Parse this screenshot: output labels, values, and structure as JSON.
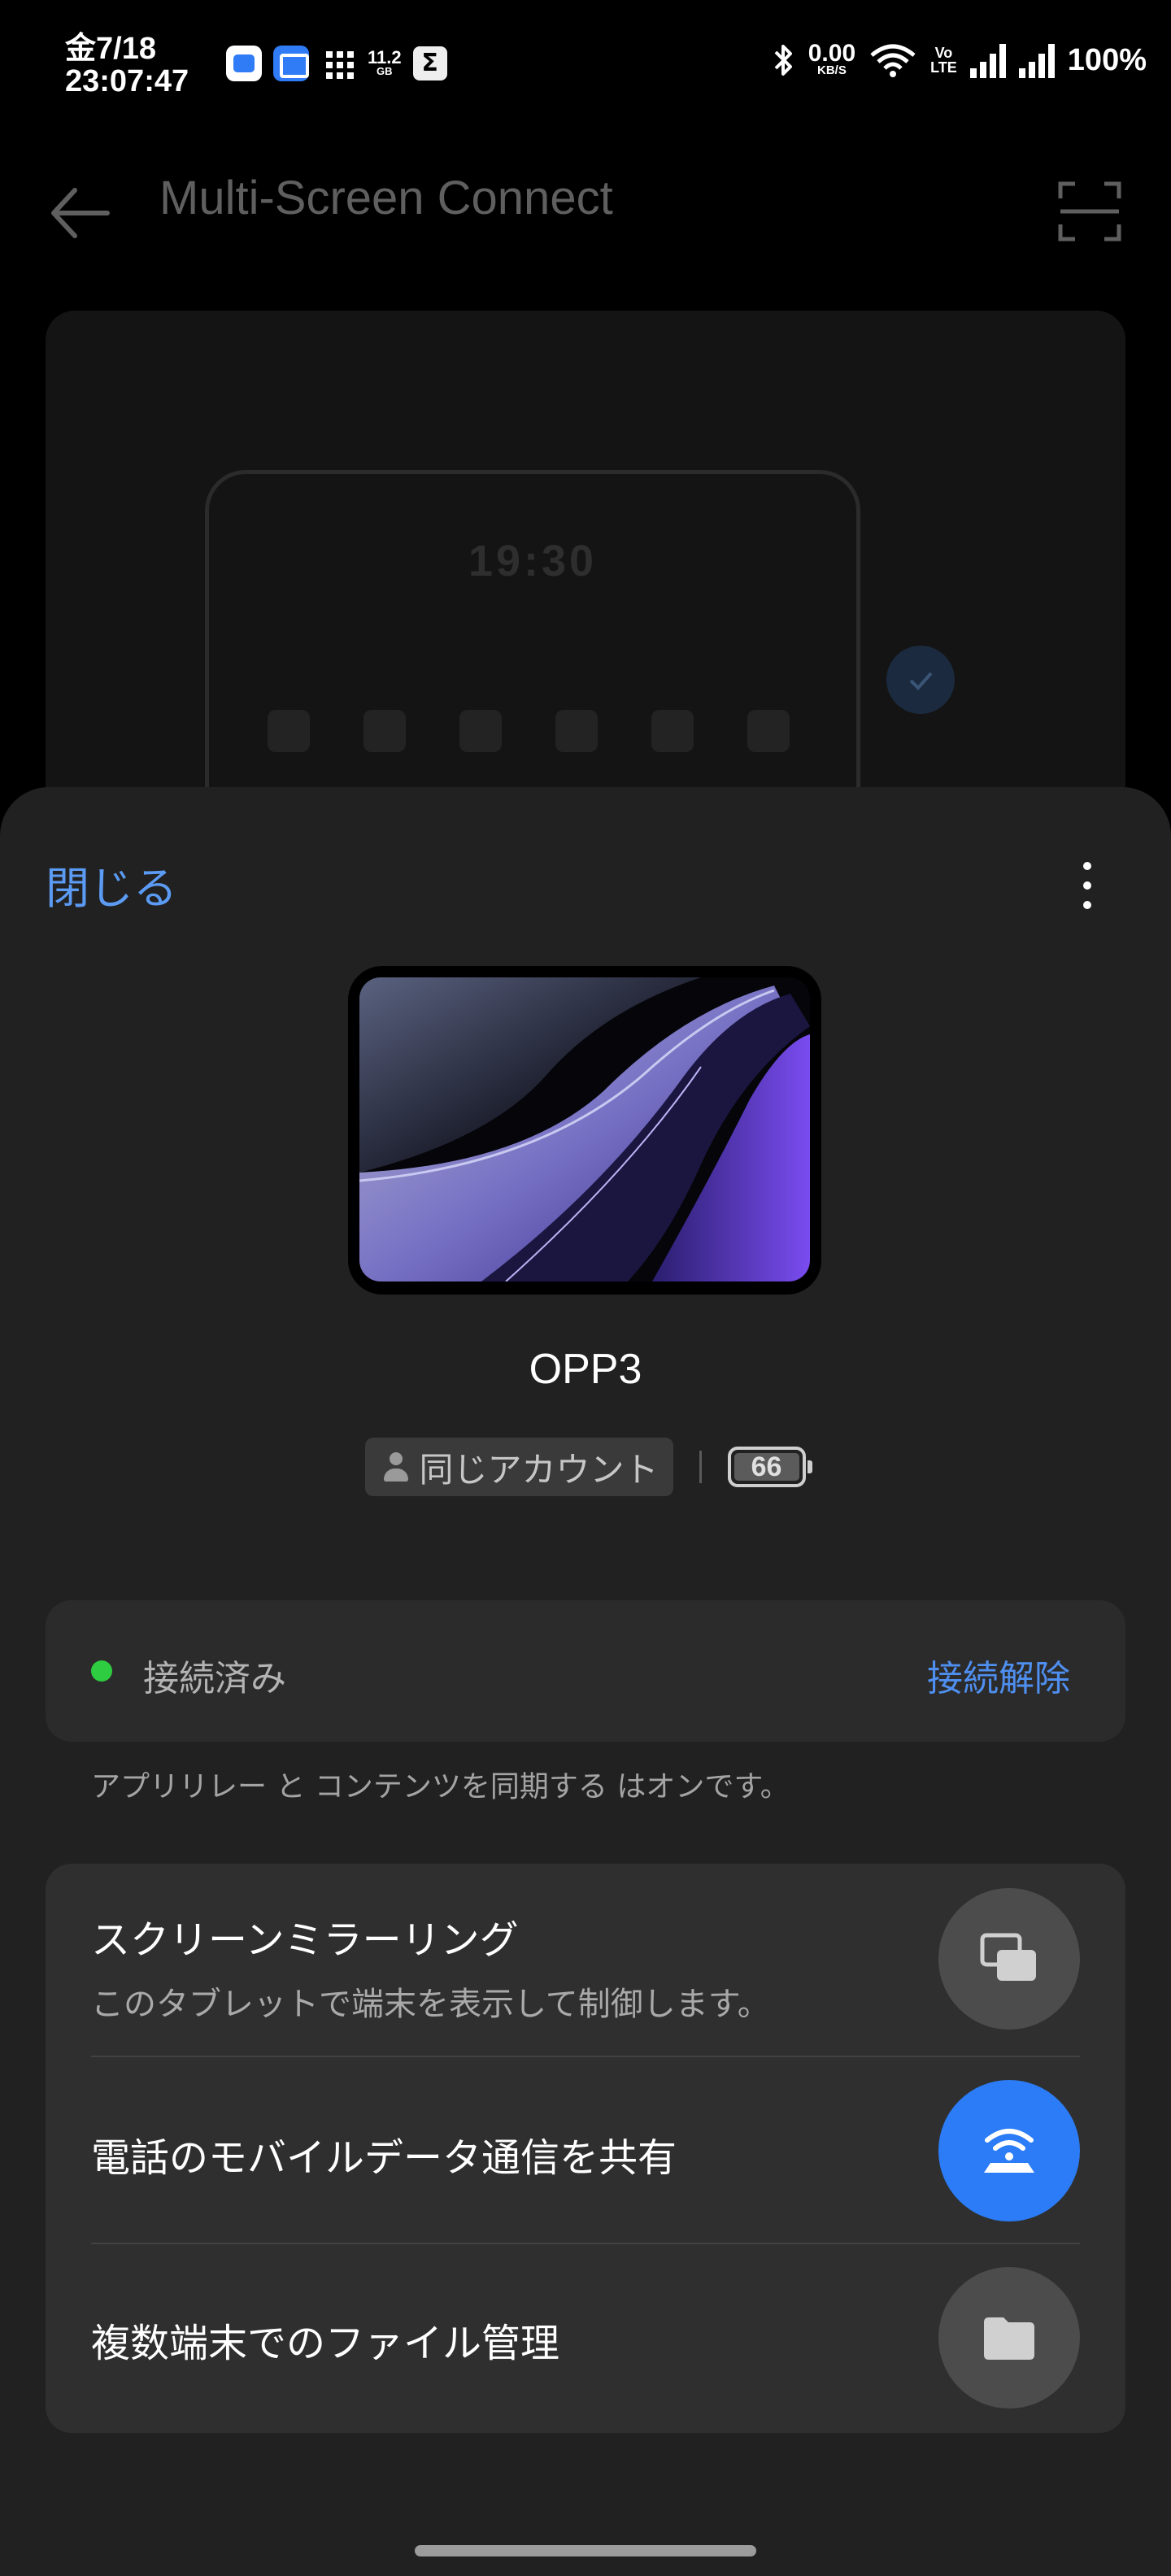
{
  "status_bar": {
    "date": "金7/18",
    "time": "23:07:47",
    "storage_value": "11.2",
    "storage_unit": "GB",
    "net_speed": "0.00",
    "net_speed_unit": "KB/S",
    "volte_top": "Vo",
    "volte_bottom": "LTE",
    "battery": "100%"
  },
  "header": {
    "title": "Multi-Screen Connect"
  },
  "preview": {
    "clock": "19:30"
  },
  "sheet": {
    "close_label": "閉じる",
    "device_name": "OPP3",
    "account_label": "同じアカウント",
    "battery_level": "66",
    "status_label": "接続済み",
    "disconnect_label": "接続解除",
    "note": "アプリリレー と コンテンツを同期する はオンです。",
    "features": [
      {
        "title": "スクリーンミラーリング",
        "subtitle": "このタブレットで端末を表示して制御します。",
        "icon": "screen-mirroring-icon",
        "active": false
      },
      {
        "title": "電話のモバイルデータ通信を共有",
        "subtitle": "",
        "icon": "mobile-hotspot-icon",
        "active": true
      },
      {
        "title": "複数端末でのファイル管理",
        "subtitle": "",
        "icon": "folder-icon",
        "active": false
      }
    ]
  },
  "colors": {
    "accent": "#4f8ff0",
    "active_button": "#2b7cf6",
    "connected": "#2ecc40"
  }
}
